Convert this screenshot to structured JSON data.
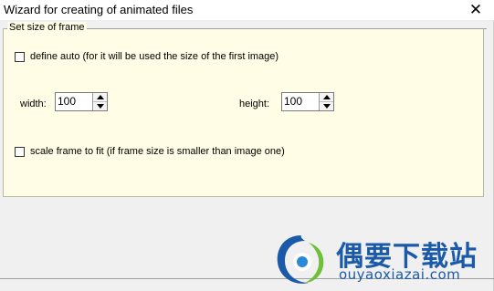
{
  "window": {
    "title": "Wizard for creating of animated files",
    "close_glyph": "✕"
  },
  "group": {
    "label": "Set size of frame"
  },
  "define_auto": {
    "label": "define auto (for it will be used the size of the first image)",
    "checked": false
  },
  "width": {
    "label": "width:",
    "value": "100"
  },
  "height": {
    "label": "height:",
    "value": "100"
  },
  "scale_fit": {
    "label": "scale frame to fit (if frame size is smaller than image one)",
    "checked": false
  },
  "watermark": {
    "brand": "偶要下载站",
    "url": "ouyaoxiazai.com",
    "color": "#1a5aa8"
  },
  "colors": {
    "panel_bg": "#fffde5",
    "window_bg": "#f0f0f0"
  }
}
